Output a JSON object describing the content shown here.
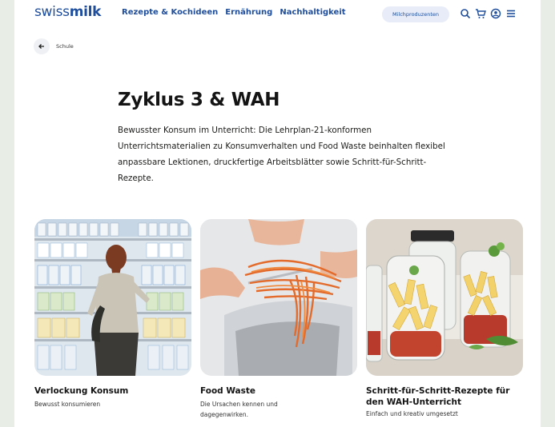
{
  "header": {
    "logo_light": "swiss",
    "logo_bold": "milk",
    "nav": [
      "Rezepte & Kochideen",
      "Ernährung",
      "Nachhaltigkeit"
    ],
    "producer_button": "Milchproduzenten",
    "icons": [
      "search-icon",
      "cart-icon",
      "account-icon",
      "menu-icon"
    ]
  },
  "back": {
    "label": "Schule"
  },
  "main": {
    "title": "Zyklus 3 & WAH",
    "intro": "Bewusster Konsum im Unterricht: Die Lehrplan-21-konformen Unterrichtsmaterialien zu Konsumverhalten und Food Waste beinhalten flexibel anpassbare Lektionen, druckfertige Arbeitsblätter sowie Schritt-für-Schritt-Rezepte."
  },
  "cards": [
    {
      "title": "Verlockung Konsum",
      "subtitle": "Bewusst konsumieren"
    },
    {
      "title": "Food Waste",
      "subtitle": "Die Ursachen kennen und dagegenwirken."
    },
    {
      "title": "Schritt-für-Schritt-Rezepte für den WAH-Unterricht",
      "subtitle": "Einfach und kreativ umgesetzt"
    }
  ],
  "colors": {
    "brand": "#1f4e9c",
    "page_bg": "#e8eee5"
  }
}
